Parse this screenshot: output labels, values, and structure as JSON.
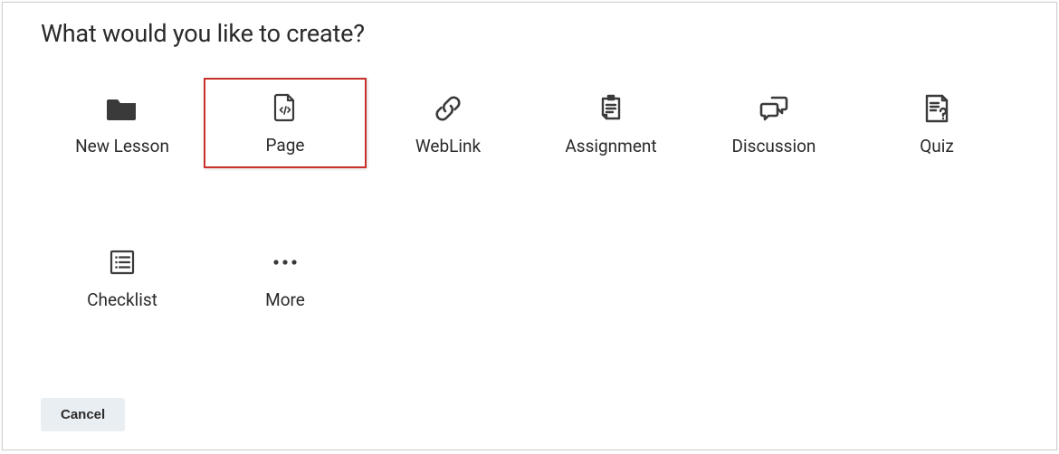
{
  "heading": "What would you like to create?",
  "options": {
    "new_lesson": {
      "label": "New Lesson"
    },
    "page": {
      "label": "Page"
    },
    "weblink": {
      "label": "WebLink"
    },
    "assignment": {
      "label": "Assignment"
    },
    "discussion": {
      "label": "Discussion"
    },
    "quiz": {
      "label": "Quiz"
    },
    "checklist": {
      "label": "Checklist"
    },
    "more": {
      "label": "More"
    }
  },
  "buttons": {
    "cancel": "Cancel"
  }
}
